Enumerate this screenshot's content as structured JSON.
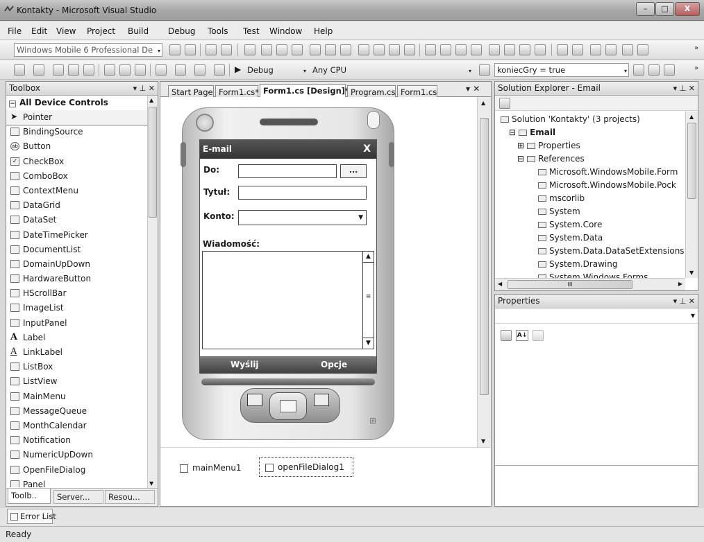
{
  "window": {
    "title": "Kontakty - Microsoft Visual Studio",
    "min": "–",
    "max": "□",
    "close": "X"
  },
  "menu": [
    "File",
    "Edit",
    "View",
    "Project",
    "Build",
    "Debug",
    "Tools",
    "Test",
    "Window",
    "Help"
  ],
  "toolbar": {
    "platform": "Windows Mobile 6 Professional De",
    "config": "Debug",
    "cpu": "Any CPU",
    "find": "koniecGry = true"
  },
  "toolbox": {
    "title": "Toolbox",
    "header_btns": "▾ ⊥ ✕",
    "group": "All Device Controls",
    "items": [
      "Pointer",
      "BindingSource",
      "Button",
      "CheckBox",
      "ComboBox",
      "ContextMenu",
      "DataGrid",
      "DataSet",
      "DateTimePicker",
      "DocumentList",
      "DomainUpDown",
      "HardwareButton",
      "HScrollBar",
      "ImageList",
      "InputPanel",
      "Label",
      "LinkLabel",
      "ListBox",
      "ListView",
      "MainMenu",
      "MessageQueue",
      "MonthCalendar",
      "Notification",
      "NumericUpDown",
      "OpenFileDialog",
      "Panel"
    ],
    "bottom_tabs": [
      "Toolb..",
      "Server...",
      "Resou..."
    ]
  },
  "tabs": [
    "Start Page",
    "Form1.cs*",
    "Form1.cs [Design]*",
    "Program.cs",
    "Form1.cs"
  ],
  "tabs_btns": "▾ ✕",
  "form": {
    "title": "E-mail",
    "close": "X",
    "do_label": "Do:",
    "browse": "...",
    "tytul_label": "Tytuł:",
    "konto_label": "Konto:",
    "wiadomosc_label": "Wiadomość:",
    "menu_left": "Wyślij",
    "menu_right": "Opcje"
  },
  "tray": [
    "mainMenu1",
    "openFileDialog1"
  ],
  "solution": {
    "title": "Solution Explorer - Email",
    "header_btns": "▾ ⊥ ✕",
    "items": [
      {
        "label": "Solution 'Kontakty' (3 projects)",
        "indent": 0,
        "bold": false
      },
      {
        "label": "Email",
        "indent": 1,
        "bold": true
      },
      {
        "label": "Properties",
        "indent": 2,
        "bold": false
      },
      {
        "label": "References",
        "indent": 2,
        "bold": false
      },
      {
        "label": "Microsoft.WindowsMobile.Form",
        "indent": 3,
        "bold": false
      },
      {
        "label": "Microsoft.WindowsMobile.Pock",
        "indent": 3,
        "bold": false
      },
      {
        "label": "mscorlib",
        "indent": 3,
        "bold": false
      },
      {
        "label": "System",
        "indent": 3,
        "bold": false
      },
      {
        "label": "System.Core",
        "indent": 3,
        "bold": false
      },
      {
        "label": "System.Data",
        "indent": 3,
        "bold": false
      },
      {
        "label": "System.Data.DataSetExtensions",
        "indent": 3,
        "bold": false
      },
      {
        "label": "System.Drawing",
        "indent": 3,
        "bold": false
      },
      {
        "label": "System.Windows.Forms",
        "indent": 3,
        "bold": false
      }
    ],
    "hscroll_mark": "III"
  },
  "properties": {
    "title": "Properties",
    "header_btns": "▾ ⊥ ✕",
    "sort_icon": "A↓"
  },
  "errorlist": "Error List",
  "status": "Ready"
}
